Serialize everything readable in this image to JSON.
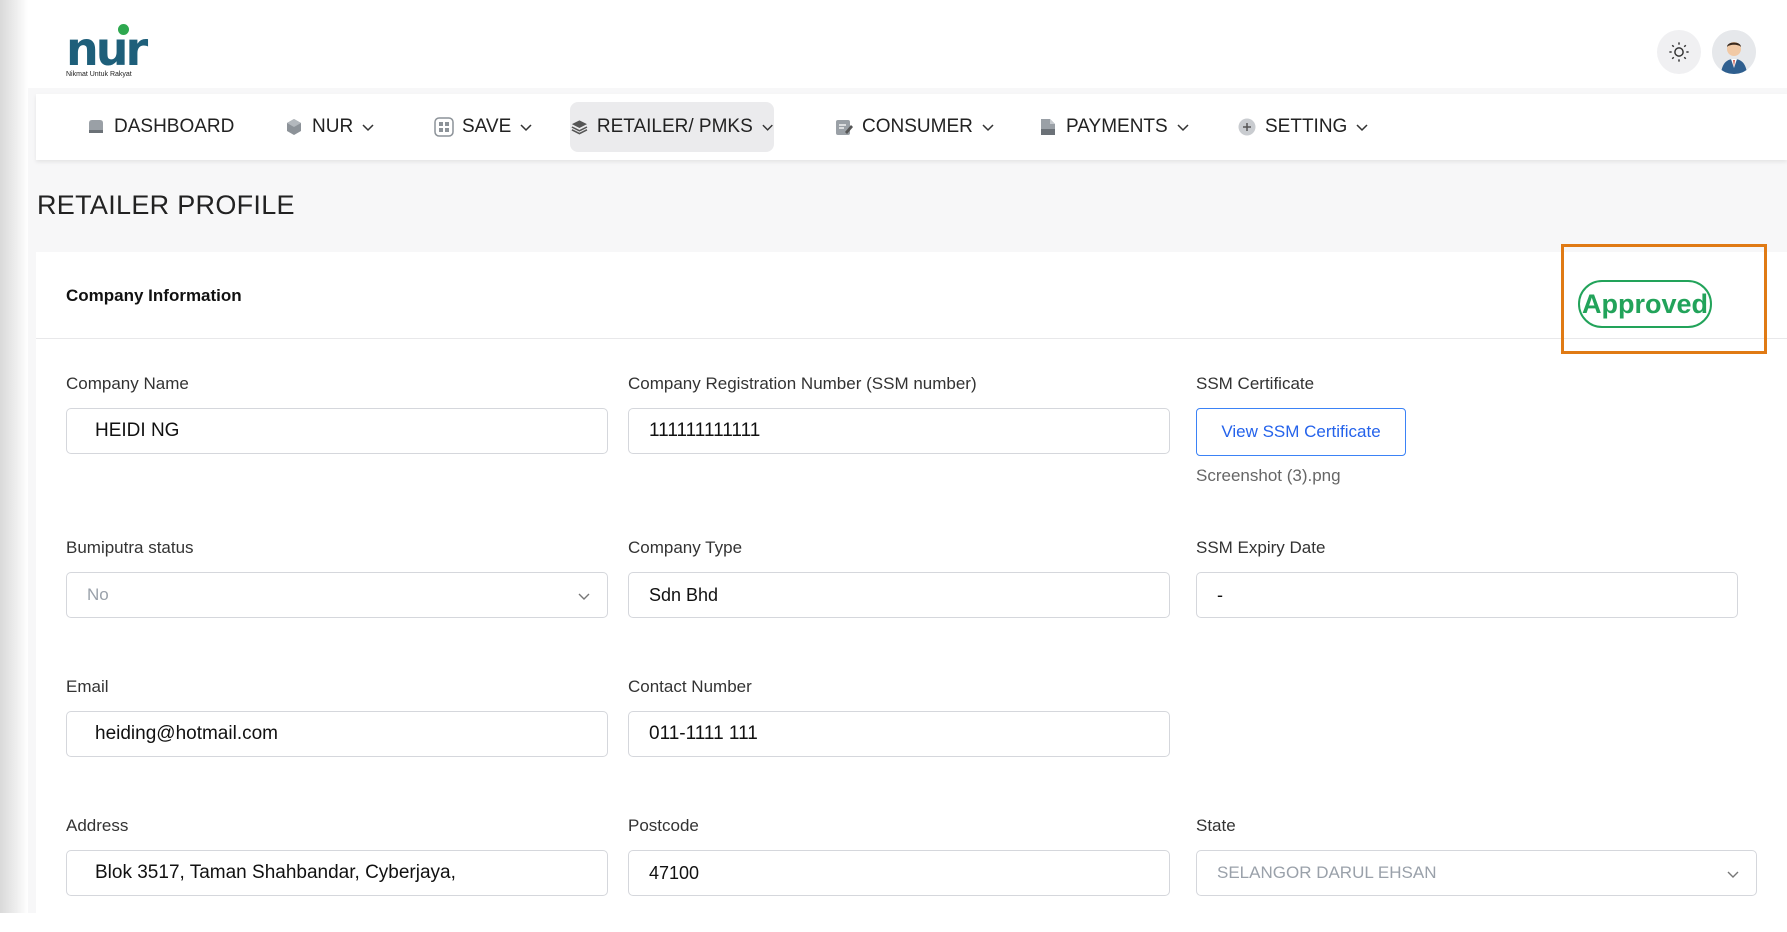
{
  "brand": {
    "logo_text": "nur",
    "tagline": "Nikmat Untuk Rakyat"
  },
  "nav": {
    "items": [
      {
        "label": "DASHBOARD",
        "icon": "dashboard-icon"
      },
      {
        "label": "NUR",
        "icon": "cube-icon"
      },
      {
        "label": "SAVE",
        "icon": "grid-icon"
      },
      {
        "label": "RETAILER/ PMKS",
        "icon": "layers-icon",
        "active": true
      },
      {
        "label": "CONSUMER",
        "icon": "edit-document-icon"
      },
      {
        "label": "PAYMENTS",
        "icon": "document-icon"
      },
      {
        "label": "SETTING",
        "icon": "plus-circle-icon"
      }
    ]
  },
  "page": {
    "title": "RETAILER PROFILE"
  },
  "card": {
    "title": "Company Information",
    "status": "Approved",
    "status_color": "#22a35a",
    "highlight_color": "#e07a14"
  },
  "form": {
    "company_name": {
      "label": "Company Name",
      "value": "HEIDI NG"
    },
    "registration": {
      "label": "Company Registration Number (SSM number)",
      "value": "111111111111"
    },
    "ssm_certificate": {
      "label": "SSM Certificate",
      "button": "View SSM Certificate",
      "file": "Screenshot (3).png"
    },
    "bumiputra": {
      "label": "Bumiputra status",
      "value": "No"
    },
    "company_type": {
      "label": "Company Type",
      "value": "Sdn Bhd"
    },
    "ssm_expiry": {
      "label": "SSM Expiry Date",
      "value": "-"
    },
    "email": {
      "label": "Email",
      "value": "heiding@hotmail.com"
    },
    "contact": {
      "label": "Contact Number",
      "value": "011-1111 111"
    },
    "address": {
      "label": "Address",
      "value": "Blok 3517, Taman Shahbandar, Cyberjaya,"
    },
    "postcode": {
      "label": "Postcode",
      "value": "47100"
    },
    "state": {
      "label": "State",
      "value": "SELANGOR DARUL EHSAN"
    }
  },
  "colors": {
    "accent_blue": "#2563eb",
    "nav_active_bg": "#ebebed"
  }
}
